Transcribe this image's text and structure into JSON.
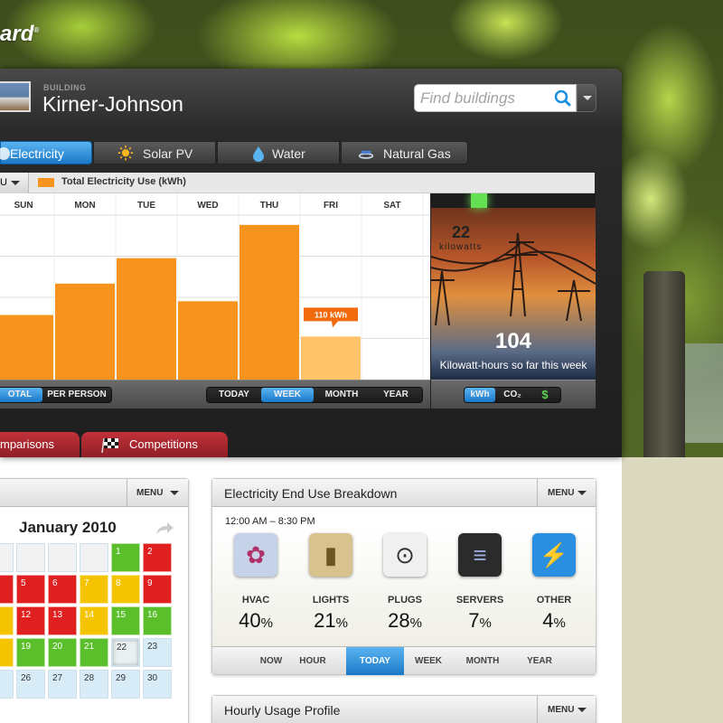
{
  "app": {
    "logo_text": "ard",
    "logo_mark": "®"
  },
  "building": {
    "caption": "BUILDING",
    "name": "Kirner-Johnson"
  },
  "search": {
    "placeholder": "Find buildings"
  },
  "resource_tabs": [
    {
      "label": "Electricity",
      "icon": "plug-icon",
      "active": true
    },
    {
      "label": "Solar PV",
      "icon": "sun-icon",
      "active": false
    },
    {
      "label": "Water",
      "icon": "water-drop-icon",
      "active": false
    },
    {
      "label": "Natural Gas",
      "icon": "gas-burner-icon",
      "active": false
    }
  ],
  "chart_header": {
    "dropdown_text": "U",
    "legend_label": "Total Electricity Use (kWh)",
    "legend_color": "#f7941d"
  },
  "chart_data": {
    "type": "bar",
    "categories": [
      "SUN",
      "MON",
      "TUE",
      "WED",
      "THU",
      "FRI",
      "SAT"
    ],
    "values": [
      165,
      245,
      310,
      200,
      395,
      110,
      null
    ],
    "title": "",
    "series": [
      {
        "name": "Total Electricity Use (kWh)",
        "values": [
          165,
          245,
          310,
          200,
          395,
          110,
          null
        ]
      }
    ],
    "highlight": {
      "category": "FRI",
      "label": "110 kWh",
      "color": "#ffc36a"
    },
    "bar_color": "#f7941d",
    "ylim": [
      0,
      420
    ],
    "grid": true
  },
  "live": {
    "kilowatts": "22",
    "kilowatts_unit": "kilowatts",
    "week_total": "104",
    "caption": "Kilowatt-hours so far this week"
  },
  "toolbar_left": {
    "options": [
      "OTAL",
      "PER PERSON"
    ],
    "selected": "OTAL"
  },
  "toolbar_mid": {
    "options": [
      "TODAY",
      "WEEK",
      "MONTH",
      "YEAR"
    ],
    "selected": "WEEK"
  },
  "toolbar_right": {
    "options": [
      "kWh",
      "CO₂",
      "$"
    ],
    "selected": "kWh"
  },
  "section_tabs": [
    {
      "label": "mparisons",
      "icon": ""
    },
    {
      "label": "Competitions",
      "icon": "checkered-flag-icon"
    }
  ],
  "calendar": {
    "menu_label": "MENU",
    "month": "January 2010",
    "colors": {
      "red": "#e02020",
      "yellow": "#f5c400",
      "green": "#5bbf2c",
      "future": "#d8ecf7",
      "blank": "#f2f2f2"
    },
    "rows": [
      [
        {
          "d": "",
          "c": "blank"
        },
        {
          "d": "",
          "c": "blank"
        },
        {
          "d": "",
          "c": "blank"
        },
        {
          "d": "",
          "c": "blank"
        },
        {
          "d": "1",
          "c": "green"
        },
        {
          "d": "2",
          "c": "red"
        }
      ],
      [
        {
          "d": "",
          "c": "red"
        },
        {
          "d": "5",
          "c": "red"
        },
        {
          "d": "6",
          "c": "red"
        },
        {
          "d": "7",
          "c": "yellow"
        },
        {
          "d": "8",
          "c": "yellow"
        },
        {
          "d": "9",
          "c": "red"
        }
      ],
      [
        {
          "d": "",
          "c": "yellow"
        },
        {
          "d": "12",
          "c": "red"
        },
        {
          "d": "13",
          "c": "red"
        },
        {
          "d": "14",
          "c": "yellow"
        },
        {
          "d": "15",
          "c": "green"
        },
        {
          "d": "16",
          "c": "green"
        }
      ],
      [
        {
          "d": "",
          "c": "yellow"
        },
        {
          "d": "19",
          "c": "green"
        },
        {
          "d": "20",
          "c": "green"
        },
        {
          "d": "21",
          "c": "green"
        },
        {
          "d": "22",
          "c": "today"
        },
        {
          "d": "23",
          "c": "future"
        }
      ],
      [
        {
          "d": "",
          "c": "future"
        },
        {
          "d": "26",
          "c": "future"
        },
        {
          "d": "27",
          "c": "future"
        },
        {
          "d": "28",
          "c": "future"
        },
        {
          "d": "29",
          "c": "future"
        },
        {
          "d": "30",
          "c": "future"
        }
      ]
    ]
  },
  "end_use": {
    "title": "Electricity End Use Breakdown",
    "menu_label": "MENU",
    "time_range": "12:00 AM – 8:30 PM",
    "items": [
      {
        "label": "HVAC",
        "value": "40",
        "unit": "%",
        "icon": "fan-icon"
      },
      {
        "label": "LIGHTS",
        "value": "21",
        "unit": "%",
        "icon": "light-switch-icon"
      },
      {
        "label": "PLUGS",
        "value": "28",
        "unit": "%",
        "icon": "outlet-icon"
      },
      {
        "label": "SERVERS",
        "value": "7",
        "unit": "%",
        "icon": "server-icon"
      },
      {
        "label": "OTHER",
        "value": "4",
        "unit": "%",
        "icon": "lightning-icon"
      }
    ],
    "time_options": [
      "NOW",
      "HOUR",
      "TODAY",
      "WEEK",
      "MONTH",
      "YEAR"
    ],
    "time_selected": "TODAY"
  },
  "hourly": {
    "title": "Hourly Usage Profile",
    "menu_label": "MENU"
  }
}
